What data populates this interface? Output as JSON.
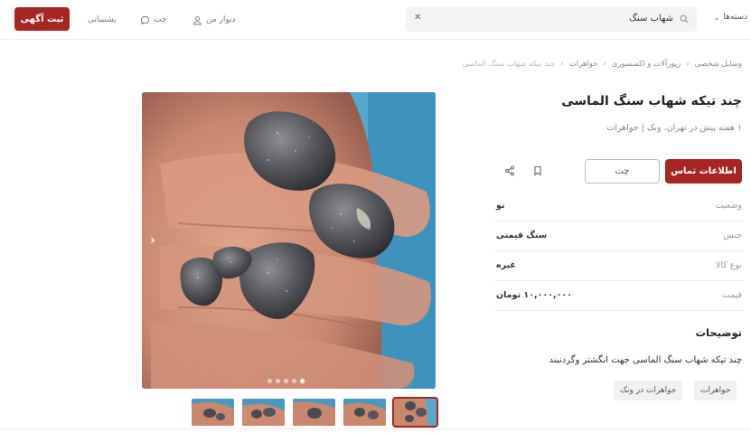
{
  "header": {
    "post_button": "ثبت آگهی",
    "support": "پشتیبانی",
    "chat": "چت",
    "my_divar": "دیوار من",
    "search_value": "شهاب سنگ",
    "categories": "دسته‌ها"
  },
  "breadcrumb": [
    "وسایل شخصی",
    "زیورآلات و اکسسوری",
    "جواهرات",
    "چند تیکه شهاب سنگ الماسی"
  ],
  "ad": {
    "title": "چند تیکه شهاب سنگ الماسی",
    "subtitle": "۱ هفته پیش در تهران، ونک | جواهرات",
    "contact_button": "اطلاعات تماس",
    "chat_button": "چت",
    "attributes": [
      {
        "key": "وضعیت",
        "value": "نو"
      },
      {
        "key": "جنس",
        "value": "سنگ قیمتی"
      },
      {
        "key": "نوع کالا",
        "value": "غیره"
      },
      {
        "key": "قیمت",
        "value": "۱۰,۰۰۰,۰۰۰ تومان"
      }
    ],
    "description_title": "توضیحات",
    "description": "چند تیکه شهاب سنگ الماسی جهت انگشتر وگردنبند",
    "tags": [
      "جواهرات",
      "جواهرات در ونک"
    ]
  },
  "gallery": {
    "dot_count": 5,
    "active_dot": 5,
    "thumb_count": 5,
    "next_arrow": "›"
  },
  "colors": {
    "brand": "#a62626"
  }
}
